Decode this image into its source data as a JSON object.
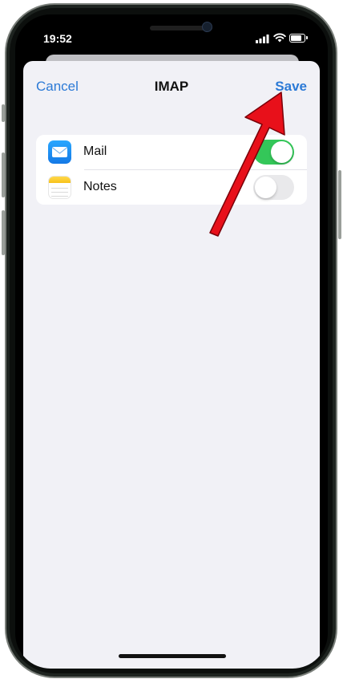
{
  "status_bar": {
    "time": "19:52"
  },
  "nav": {
    "cancel_label": "Cancel",
    "title": "IMAP",
    "save_label": "Save"
  },
  "rows": [
    {
      "label": "Mail",
      "icon": "mail-icon",
      "enabled": true
    },
    {
      "label": "Notes",
      "icon": "notes-icon",
      "enabled": false
    }
  ],
  "colors": {
    "accent": "#2c7ad6",
    "toggle_on": "#34c759",
    "toggle_off": "#e9e9eb",
    "sheet_background": "#f1f1f6",
    "annotation_arrow": "#e8101a"
  }
}
